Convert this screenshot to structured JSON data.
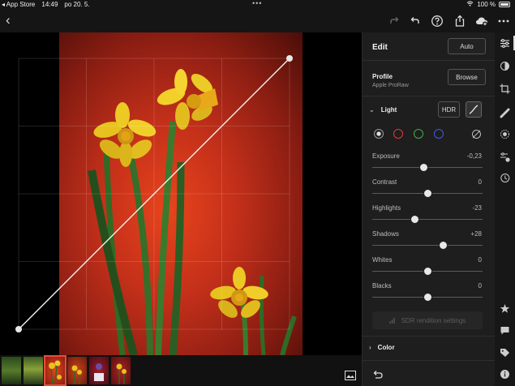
{
  "status": {
    "back_app": "◂ App Store",
    "time": "14:49",
    "date": "po 20. 5.",
    "more": "•••",
    "battery": "100 %"
  },
  "toolbar": {
    "back_glyph": "‹",
    "icons": [
      "redo-icon",
      "undo-icon",
      "help-icon",
      "share-icon",
      "cloud-add-icon",
      "more-icon"
    ]
  },
  "panel": {
    "title": "Edit",
    "auto_label": "Auto",
    "profile_label": "Profile",
    "profile_value": "Apple ProRaw",
    "browse_label": "Browse",
    "light_label": "Light",
    "hdr_label": "HDR",
    "sliders": [
      {
        "name": "exposure",
        "label": "Exposure",
        "value": "-0,23",
        "level": 0.47
      },
      {
        "name": "contrast",
        "label": "Contrast",
        "value": "0",
        "level": 0.5
      },
      {
        "name": "highlights",
        "label": "Highlights",
        "value": "-23",
        "level": 0.385
      },
      {
        "name": "shadows",
        "label": "Shadows",
        "value": "+28",
        "level": 0.64
      },
      {
        "name": "whites",
        "label": "Whites",
        "value": "0",
        "level": 0.5
      },
      {
        "name": "blacks",
        "label": "Blacks",
        "value": "0",
        "level": 0.5
      }
    ],
    "sdr_label": "SDR rendition settings",
    "color_label": "Color",
    "channel_colors": {
      "white": "#e0e0e0",
      "red": "#e03a3a",
      "green": "#3cb04a",
      "blue": "#3a5de0"
    }
  },
  "filmstrip": {
    "count": 6,
    "selected_index": 2
  },
  "colors": {
    "accent": "#e84d3a"
  }
}
